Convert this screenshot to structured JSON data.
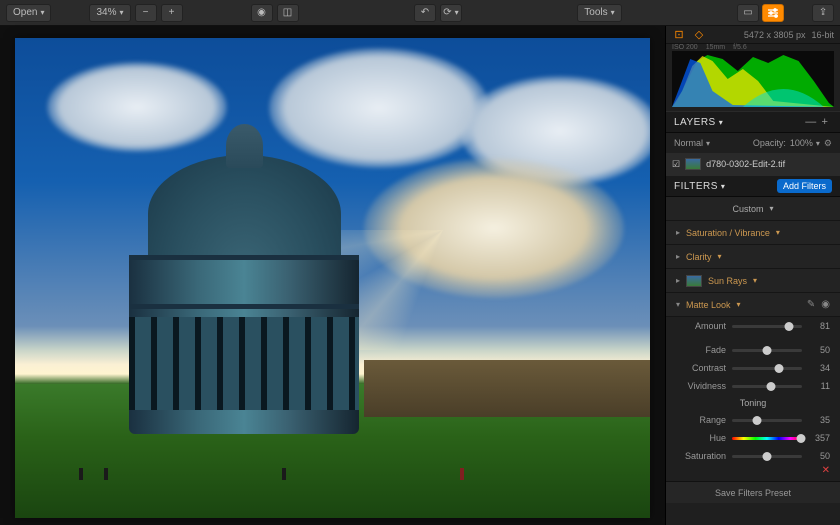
{
  "toolbar": {
    "open_label": "Open",
    "zoom_pct": "34%",
    "tools_label": "Tools"
  },
  "info": {
    "dimensions": "5472 x 3805 px",
    "bit_depth": "16-bit",
    "iso": "ISO 200",
    "focal": "15mm",
    "aperture": "f/5.6"
  },
  "layers": {
    "title": "LAYERS",
    "blend_mode": "Normal",
    "opacity_label": "Opacity:",
    "opacity_value": "100%",
    "items": [
      {
        "name": "d780-0302-Edit-2.tif"
      }
    ]
  },
  "filters": {
    "title": "FILTERS",
    "add_label": "Add Filters",
    "preset_label": "Custom",
    "items": [
      {
        "name": "Saturation / Vibrance",
        "open": false,
        "thumb": false
      },
      {
        "name": "Clarity",
        "open": false,
        "thumb": false
      },
      {
        "name": "Sun Rays",
        "open": false,
        "thumb": true
      },
      {
        "name": "Matte Look",
        "open": true,
        "thumb": false
      }
    ],
    "matte": {
      "amount": {
        "label": "Amount",
        "value": 81,
        "pos": 81
      },
      "fade": {
        "label": "Fade",
        "value": 50,
        "pos": 50
      },
      "contrast": {
        "label": "Contrast",
        "value": 34,
        "pos": 67
      },
      "vividness": {
        "label": "Vividness",
        "value": 11,
        "pos": 56
      },
      "toning_label": "Toning",
      "range": {
        "label": "Range",
        "value": 35,
        "pos": 35
      },
      "hue": {
        "label": "Hue",
        "value": 357,
        "pos": 99
      },
      "saturation": {
        "label": "Saturation",
        "value": 50,
        "pos": 50
      }
    },
    "save_preset_label": "Save Filters Preset"
  }
}
